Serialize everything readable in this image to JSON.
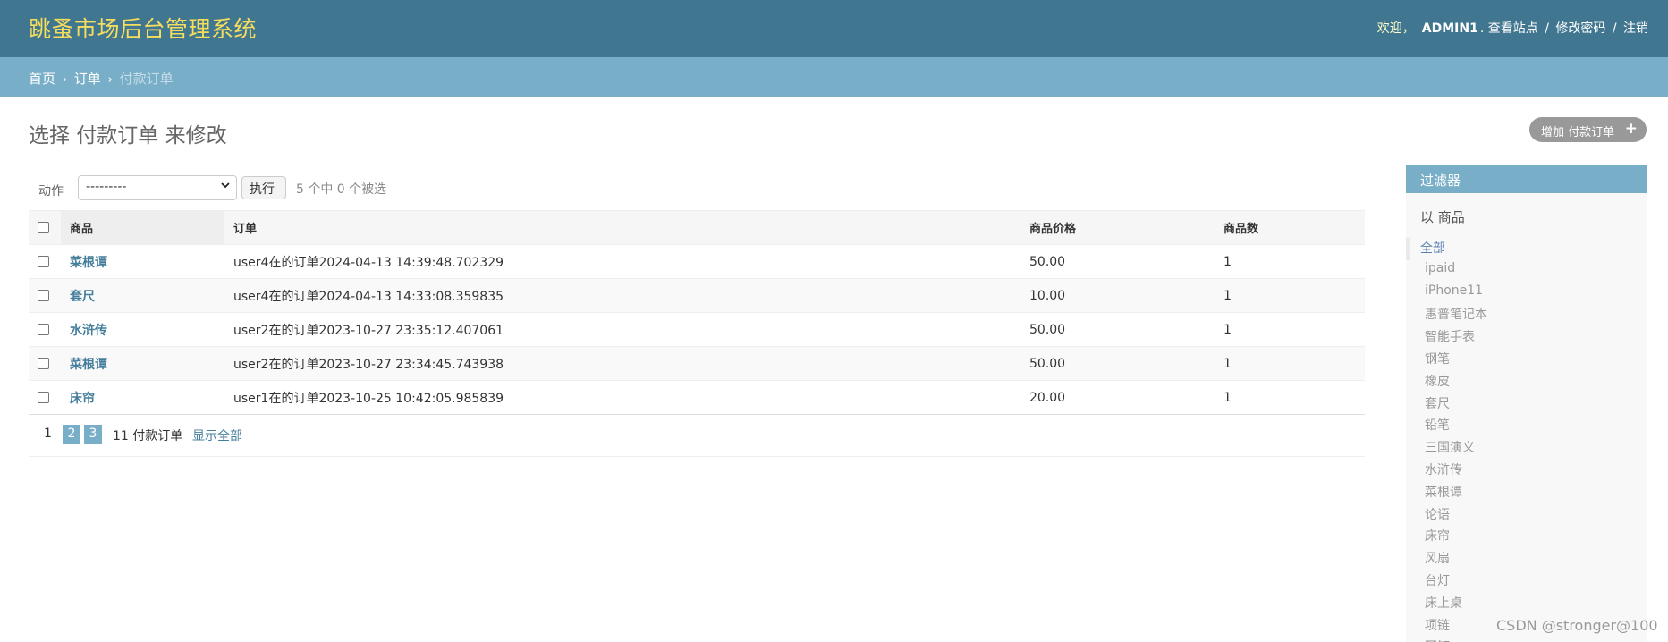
{
  "header": {
    "site_name": "跳蚤市场后台管理系统",
    "welcome": "欢迎，",
    "username": "ADMIN1",
    "username_suffix": ".",
    "view_site": "查看站点",
    "change_password": "修改密码",
    "logout": "注销",
    "separator": "/"
  },
  "breadcrumbs": {
    "home": "首页",
    "app": "订单",
    "current": "付款订单",
    "arrow": "›"
  },
  "page": {
    "title": "选择 付款订单 来修改",
    "add_button": "增加 付款订单",
    "add_icon": "+"
  },
  "actions": {
    "label": "动作",
    "select_value": "---------",
    "go_button": "执行",
    "selection_count": "5 个中 0 个被选"
  },
  "table": {
    "columns": [
      "商品",
      "订单",
      "商品价格",
      "商品数"
    ],
    "rows": [
      {
        "product": "菜根谭",
        "order": "user4在的订单2024-04-13 14:39:48.702329",
        "price": "50.00",
        "qty": "1"
      },
      {
        "product": "套尺",
        "order": "user4在的订单2024-04-13 14:33:08.359835",
        "price": "10.00",
        "qty": "1"
      },
      {
        "product": "水浒传",
        "order": "user2在的订单2023-10-27 23:35:12.407061",
        "price": "50.00",
        "qty": "1"
      },
      {
        "product": "菜根谭",
        "order": "user2在的订单2023-10-27 23:34:45.743938",
        "price": "50.00",
        "qty": "1"
      },
      {
        "product": "床帘",
        "order": "user1在的订单2023-10-25 10:42:05.985839",
        "price": "20.00",
        "qty": "1"
      }
    ]
  },
  "paginator": {
    "current": "1",
    "pages": [
      "2",
      "3"
    ],
    "total": "11 付款订单",
    "show_all": "显示全部"
  },
  "filter": {
    "title": "过滤器",
    "by": "以 商品",
    "items": [
      "全部",
      "ipaid",
      "iPhone11",
      "惠普笔记本",
      "智能手表",
      "钢笔",
      "橡皮",
      "套尺",
      "铅笔",
      "三国演义",
      "水浒传",
      "菜根谭",
      "论语",
      "床帘",
      "风扇",
      "台灯",
      "床上桌",
      "项链",
      "耳钉"
    ],
    "selected_index": 0
  },
  "watermark": "CSDN @stronger@100",
  "colors": {
    "header_bg": "#417690",
    "site_name": "#f5dd5d",
    "breadcrumb_bg": "#79aec8",
    "link": "#447e9b",
    "add_button_bg": "#999999"
  }
}
